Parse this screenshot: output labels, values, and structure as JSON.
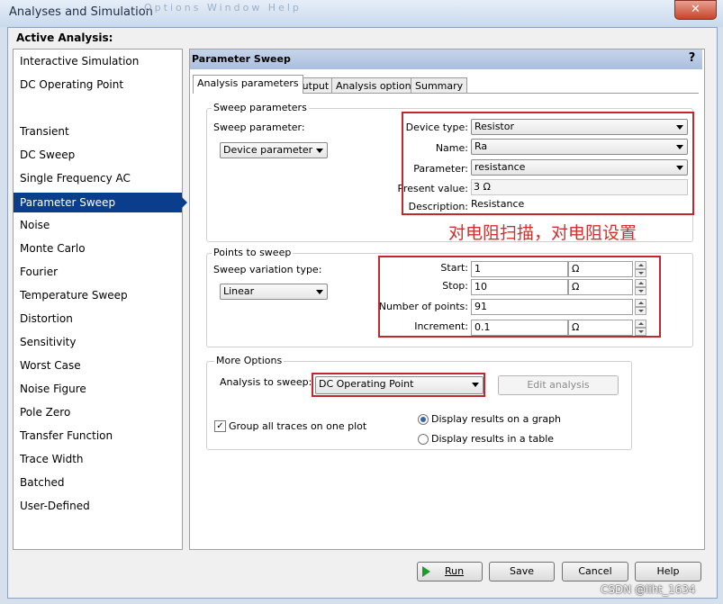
{
  "window": {
    "title": "Analyses and Simulation",
    "close_glyph": "✕",
    "ghost_menu": "Options  Window  Help"
  },
  "active_analysis_label": "Active Analysis:",
  "analyses": [
    "Interactive Simulation",
    "DC Operating Point",
    "",
    "Transient",
    "DC Sweep",
    "Single Frequency AC",
    "Parameter Sweep",
    "Noise",
    "Monte Carlo",
    "Fourier",
    "Temperature Sweep",
    "Distortion",
    "Sensitivity",
    "Worst Case",
    "Noise Figure",
    "Pole Zero",
    "Transfer Function",
    "Trace Width",
    "Batched",
    "User-Defined"
  ],
  "selected_analysis": "Parameter Sweep",
  "panel": {
    "title": "Parameter Sweep",
    "help_glyph": "?"
  },
  "tabs": [
    "Analysis parameters",
    "Output",
    "Analysis options",
    "Summary"
  ],
  "sweep_parameters": {
    "legend": "Sweep parameters",
    "sweep_parameter_label": "Sweep parameter:",
    "sweep_parameter_value": "Device parameter",
    "device_type_label": "Device type:",
    "device_type_value": "Resistor",
    "name_label": "Name:",
    "name_value": "Ra",
    "parameter_label": "Parameter:",
    "parameter_value": "resistance",
    "present_value_label": "Present value:",
    "present_value": "3 Ω",
    "description_label": "Description:",
    "description_value": "Resistance"
  },
  "annotation": "对电阻扫描，对电阻设置",
  "points_to_sweep": {
    "legend": "Points to sweep",
    "variation_label": "Sweep variation type:",
    "variation_value": "Linear",
    "start_label": "Start:",
    "start_value": "1",
    "start_unit": "Ω",
    "stop_label": "Stop:",
    "stop_value": "10",
    "stop_unit": "Ω",
    "points_label": "Number of points:",
    "points_value": "91",
    "increment_label": "Increment:",
    "increment_value": "0.1",
    "increment_unit": "Ω"
  },
  "more_options": {
    "legend": "More Options",
    "analysis_to_sweep_label": "Analysis to sweep:",
    "analysis_to_sweep_value": "DC Operating Point",
    "edit_analysis_label": "Edit analysis",
    "group_traces_label": "Group all traces on one plot",
    "group_traces_checked": true,
    "display_graph_label": "Display results on a graph",
    "display_table_label": "Display results in a table",
    "display_selected": "graph"
  },
  "buttons": {
    "run": "Run",
    "save": "Save",
    "cancel": "Cancel",
    "help": "Help"
  },
  "watermark": "CSDN @liht_1634",
  "colors": {
    "selection": "#0a3e8c",
    "highlight_box": "#c0282d",
    "annotation": "#d0302e"
  }
}
